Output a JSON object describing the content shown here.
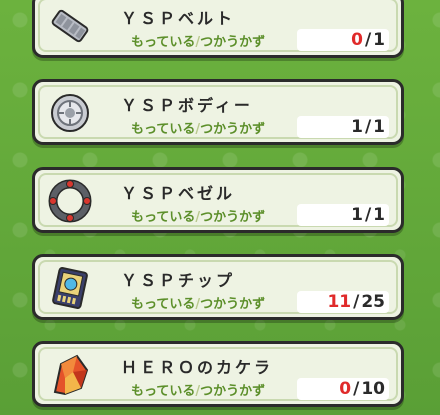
{
  "common": {
    "own_label": "もっている",
    "sep": "/",
    "need_label": "つかうかず"
  },
  "items": [
    {
      "name": "ＹＳＰベルト",
      "owned": "0",
      "needed": "1",
      "icon": "belt-icon",
      "owned_color": "#e02a2a"
    },
    {
      "name": "ＹＳＰボディー",
      "owned": "1",
      "needed": "1",
      "icon": "body-disc-icon",
      "owned_color": "#2a2a2a"
    },
    {
      "name": "ＹＳＰベゼル",
      "owned": "1",
      "needed": "1",
      "icon": "bezel-ring-icon",
      "owned_color": "#2a2a2a"
    },
    {
      "name": "ＹＳＰチップ",
      "owned": "11",
      "needed": "25",
      "icon": "chip-card-icon",
      "owned_color": "#e02a2a"
    },
    {
      "name": "ＨＥＲＯのカケラ",
      "owned": "0",
      "needed": "10",
      "icon": "hero-fragment-icon",
      "owned_color": "#e02a2a"
    }
  ]
}
